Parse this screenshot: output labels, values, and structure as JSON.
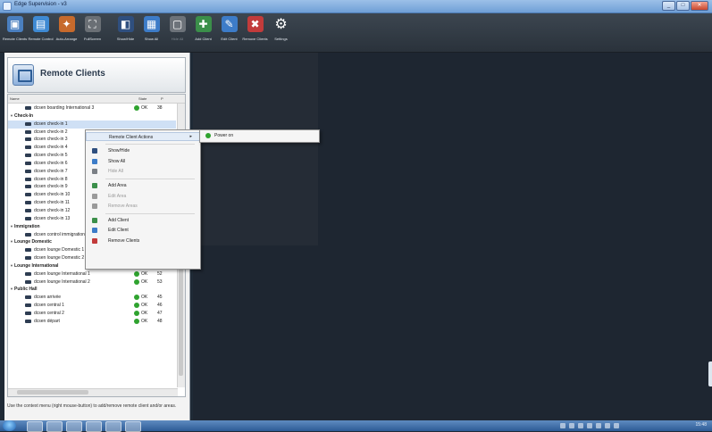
{
  "window": {
    "title": "Edge Supervision - v3"
  },
  "window_controls": {
    "minimize": "_",
    "maximize": "□",
    "close": "✕"
  },
  "toolbar": [
    {
      "label": "Remote Clients",
      "icon": "remote-clients-icon",
      "color": "#4a7fbf",
      "enabled": true
    },
    {
      "label": "Remote Control",
      "icon": "remote-control-icon",
      "color": "#3f8ad3",
      "enabled": true
    },
    {
      "label": "Auto-Arrange",
      "icon": "auto-arrange-icon",
      "color": "#c76a2c",
      "enabled": true
    },
    {
      "label": "FullScreen",
      "icon": "fullscreen-icon",
      "color": "#6a6f75",
      "enabled": true
    },
    {
      "label": "Show/Hide",
      "icon": "show-hide-icon",
      "color": "#2f4f7f",
      "enabled": true
    },
    {
      "label": "Show All",
      "icon": "show-all-icon",
      "color": "#3d7cc8",
      "enabled": true
    },
    {
      "label": "Hide All",
      "icon": "hide-all-icon",
      "color": "#6d737a",
      "enabled": false
    },
    {
      "label": "Add Client",
      "icon": "add-client-icon",
      "color": "#3b8f4a",
      "enabled": true
    },
    {
      "label": "Edit Client",
      "icon": "edit-client-icon",
      "color": "#3d7cc8",
      "enabled": true
    },
    {
      "label": "Remove Clients",
      "icon": "remove-clients-icon",
      "color": "#c23b3b",
      "enabled": true
    },
    {
      "label": "Settings",
      "icon": "settings-gear-icon",
      "color": "#2b3138",
      "enabled": true
    }
  ],
  "left_panel": {
    "title": "Remote Clients",
    "columns": {
      "name": "Name",
      "state": "State",
      "port": "P"
    },
    "hint": "Use the context menu (right mouse-button) to add/remove remote client and/or areas.",
    "rows": [
      {
        "type": "client",
        "name": "dcsen boarding International 3",
        "state": "OK",
        "port": "38",
        "dot": "#2fa32f"
      },
      {
        "type": "group",
        "name": "Check-In",
        "toggle": "▼"
      },
      {
        "type": "client",
        "name": "dcsen check-in 1",
        "state": "",
        "port": "",
        "dot": "",
        "selected": true
      },
      {
        "type": "client",
        "name": "dcsen check-in 2",
        "state": "",
        "port": "",
        "dot": ""
      },
      {
        "type": "client",
        "name": "dcsen check-in 3",
        "state": "",
        "port": "",
        "dot": ""
      },
      {
        "type": "client",
        "name": "dcsen check-in 4",
        "state": "",
        "port": "",
        "dot": ""
      },
      {
        "type": "client",
        "name": "dcsen check-in 5",
        "state": "",
        "port": "",
        "dot": ""
      },
      {
        "type": "client",
        "name": "dcsen check-in 6",
        "state": "",
        "port": "",
        "dot": ""
      },
      {
        "type": "client",
        "name": "dcsen check-in 7",
        "state": "",
        "port": "",
        "dot": ""
      },
      {
        "type": "client",
        "name": "dcsen check-in 8",
        "state": "",
        "port": "",
        "dot": ""
      },
      {
        "type": "client",
        "name": "dcsen check-in 9",
        "state": "",
        "port": "",
        "dot": ""
      },
      {
        "type": "client",
        "name": "dcsen check-in 10",
        "state": "",
        "port": "",
        "dot": ""
      },
      {
        "type": "client",
        "name": "dcsen check-in 11",
        "state": "",
        "port": "",
        "dot": ""
      },
      {
        "type": "client",
        "name": "dcsen check-in 12",
        "state": "",
        "port": "",
        "dot": ""
      },
      {
        "type": "client",
        "name": "dcsen check-in 13",
        "state": "",
        "port": "",
        "dot": ""
      },
      {
        "type": "group",
        "name": "Immigration",
        "toggle": "▼"
      },
      {
        "type": "client",
        "name": "dcsen control immigration",
        "state": "ON",
        "port": "34",
        "dot": "#f0a21c"
      },
      {
        "type": "group",
        "name": "Lounge Domestic",
        "toggle": "▼"
      },
      {
        "type": "client",
        "name": "dcsen lounge Domestic 1",
        "state": "OK",
        "port": "39",
        "dot": "#2fa32f"
      },
      {
        "type": "client",
        "name": "dcsen lounge Domestic 2",
        "state": "ON",
        "port": "40",
        "dot": "#f0a21c"
      },
      {
        "type": "group",
        "name": "Lounge International",
        "toggle": "▼"
      },
      {
        "type": "client",
        "name": "dcsen lounge International 1",
        "state": "OK",
        "port": "52",
        "dot": "#2fa32f"
      },
      {
        "type": "client",
        "name": "dcsen lounge International 2",
        "state": "OK",
        "port": "53",
        "dot": "#2fa32f"
      },
      {
        "type": "group",
        "name": "Public Hall",
        "toggle": "▼"
      },
      {
        "type": "client",
        "name": "dcsen arrivée",
        "state": "OK",
        "port": "45",
        "dot": "#2fa32f"
      },
      {
        "type": "client",
        "name": "dcsen central 1",
        "state": "OK",
        "port": "46",
        "dot": "#2fa32f"
      },
      {
        "type": "client",
        "name": "dcsen central 2",
        "state": "OK",
        "port": "47",
        "dot": "#2fa32f"
      },
      {
        "type": "client",
        "name": "dcsen départ",
        "state": "OK",
        "port": "48",
        "dot": "#2fa32f"
      }
    ]
  },
  "context_menu": [
    {
      "label": "Remote Client Actions",
      "icon": "",
      "submenu": true,
      "enabled": true,
      "hot": true
    },
    {
      "sep": true
    },
    {
      "label": "Show/Hide",
      "icon": "show-hide-icon",
      "color": "#2f4f7f",
      "enabled": true
    },
    {
      "label": "Show All",
      "icon": "show-all-icon",
      "color": "#3d7cc8",
      "enabled": true
    },
    {
      "label": "Hide All",
      "icon": "hide-all-icon",
      "color": "#7a7f85",
      "enabled": false
    },
    {
      "sep": true
    },
    {
      "label": "Add Area",
      "icon": "add-area-icon",
      "color": "#3b8f4a",
      "enabled": true
    },
    {
      "label": "Edit Area",
      "icon": "edit-area-icon",
      "color": "#9a9a9a",
      "enabled": false
    },
    {
      "label": "Remove Areas",
      "icon": "remove-areas-icon",
      "color": "#9a9a9a",
      "enabled": false
    },
    {
      "sep": true
    },
    {
      "label": "Add Client",
      "icon": "add-client-icon",
      "color": "#3b8f4a",
      "enabled": true
    },
    {
      "label": "Edit Client",
      "icon": "edit-client-icon",
      "color": "#3d7cc8",
      "enabled": true
    },
    {
      "label": "Remove Clients",
      "icon": "remove-clients-icon",
      "color": "#c23b3b",
      "enabled": true
    }
  ],
  "submenu": {
    "label": "Power on",
    "icon": "power-on-icon",
    "color": "#2fa32f"
  },
  "taskbar": {
    "clock": "15:48"
  }
}
